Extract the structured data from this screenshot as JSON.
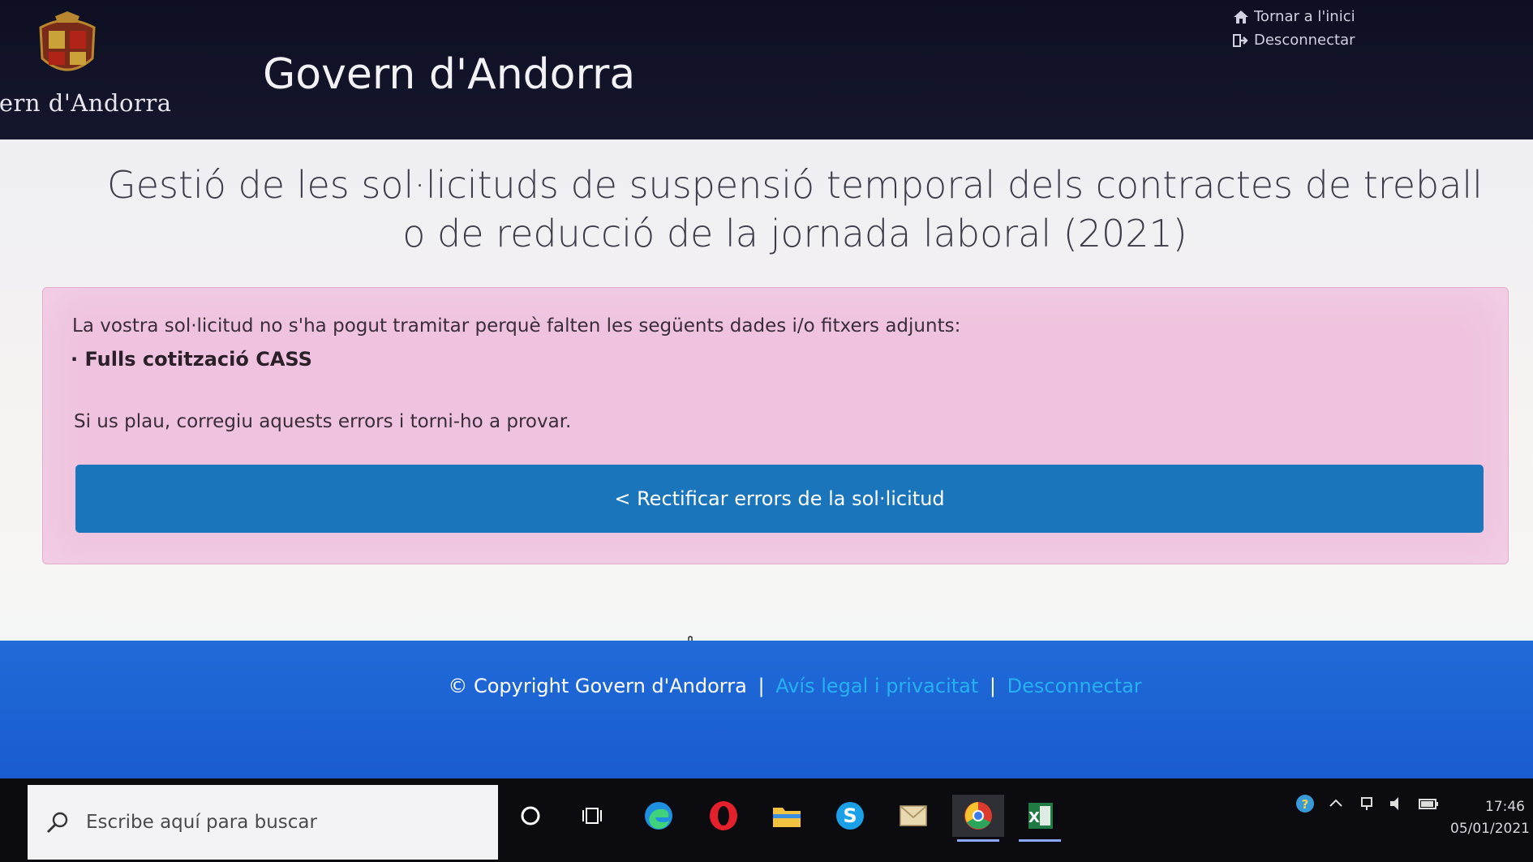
{
  "header": {
    "logo_text": "vern d'Andorra",
    "site_title": "Govern d'Andorra",
    "links": {
      "home": "Tornar a l'inici",
      "logout": "Desconnectar"
    }
  },
  "main": {
    "heading_line1": "Gestió de les sol·licituds de suspensió temporal dels contractes de treball",
    "heading_line2": "o de reducció de la jornada laboral (2021)",
    "alert": {
      "message": "La vostra sol·licitud no s'ha pogut tramitar perquè falten les següents dades i/o fitxers adjunts:",
      "missing_item": "· Fulls cotització CASS",
      "help": "Si us plau, corregiu aquests errors i torni-ho a provar.",
      "button_label": "< Rectificar errors de la sol·licitud"
    }
  },
  "footer": {
    "copyright": "© Copyright Govern d'Andorra",
    "separator": "|",
    "legal_link": "Avís legal i privacitat",
    "logout_link": "Desconnectar"
  },
  "taskbar": {
    "search_placeholder": "Escribe aquí para buscar",
    "time": "17:46",
    "date": "05/01/2021"
  },
  "colors": {
    "header_bg": "#0e0f22",
    "alert_bg": "#efc3df",
    "button_bg": "#1a75ba",
    "footer_bg": "#1f6bd8",
    "footer_link": "#27b0f2"
  }
}
